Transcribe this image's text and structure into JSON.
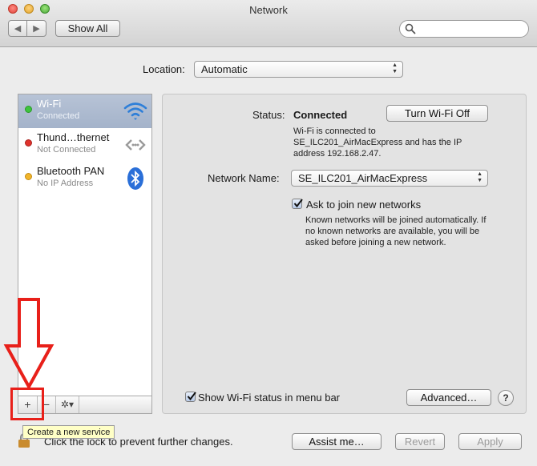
{
  "window": {
    "title": "Network"
  },
  "toolbar": {
    "back_glyph": "◀",
    "forward_glyph": "▶",
    "show_all_label": "Show All",
    "search": {
      "value": "",
      "placeholder": ""
    }
  },
  "location": {
    "label": "Location:",
    "value": "Automatic"
  },
  "services": [
    {
      "name": "Wi-Fi",
      "status": "Connected",
      "dot_color": "#3ec43e",
      "icon": "wifi-icon",
      "selected": true
    },
    {
      "name": "Thund…thernet",
      "status": "Not Connected",
      "dot_color": "#e0322c",
      "icon": "ethernet-arrows-icon",
      "selected": false
    },
    {
      "name": "Bluetooth PAN",
      "status": "No IP Address",
      "dot_color": "#f2b52a",
      "icon": "bluetooth-icon",
      "selected": false
    }
  ],
  "service_bar": {
    "add": "+",
    "remove": "−",
    "gear": "✲▾"
  },
  "tooltip": "Create a new service",
  "detail": {
    "status_label": "Status:",
    "status_value": "Connected",
    "turn_off_label": "Turn Wi-Fi Off",
    "status_description": "Wi-Fi is connected to SE_ILC201_AirMacExpress and has the IP address 192.168.2.47.",
    "network_name_label": "Network Name:",
    "network_name_value": "SE_ILC201_AirMacExpress",
    "ask_join_label": "Ask to join new networks",
    "ask_join_checked": true,
    "ask_join_description": "Known networks will be joined automatically. If no known networks are available, you will be asked before joining a new network.",
    "show_status_label": "Show Wi-Fi status in menu bar",
    "show_status_checked": true,
    "advanced_label": "Advanced…",
    "help_label": "?"
  },
  "footer": {
    "lock_text": "Click the lock to prevent further changes.",
    "assist_label": "Assist me…",
    "revert_label": "Revert",
    "apply_label": "Apply"
  },
  "colors": {
    "annotation_red": "#e8201a",
    "selection": "#a4b3ca",
    "wifi_blue": "#2f7fd8",
    "bluetooth_blue": "#2a6fd8"
  }
}
